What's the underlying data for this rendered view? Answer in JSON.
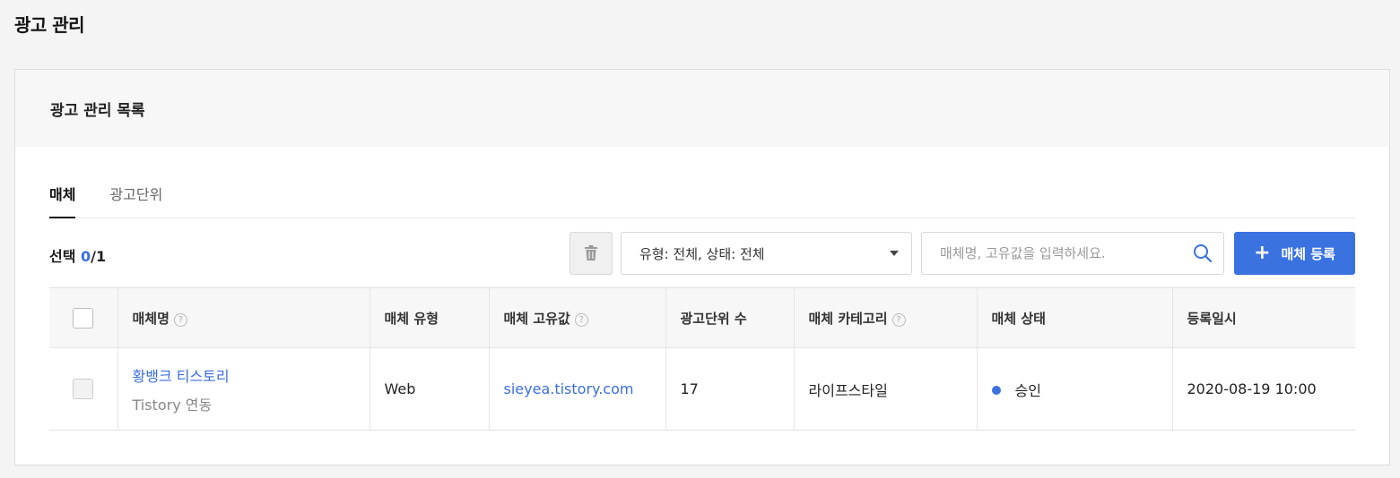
{
  "page": {
    "title": "광고 관리"
  },
  "card": {
    "title": "광고 관리 목록"
  },
  "tabs": [
    {
      "label": "매체",
      "active": true
    },
    {
      "label": "광고단위",
      "active": false
    }
  ],
  "toolbar": {
    "selection_label": "선택",
    "selected": "0",
    "total": "/1",
    "filter_value": "유형: 전체, 상태: 전체",
    "search_placeholder": "매체명, 고유값을 입력하세요.",
    "add_label": "매체 등록"
  },
  "table": {
    "headers": [
      "매체명",
      "매체 유형",
      "매체 고유값",
      "광고단위 수",
      "매체 카테고리",
      "매체 상태",
      "등록일시"
    ],
    "rows": [
      {
        "name": "황뱅크 티스토리",
        "sub": "Tistory 연동",
        "type": "Web",
        "unique_value": "sieyea.tistory.com",
        "ad_unit_count": "17",
        "category": "라이프스타일",
        "status": "승인",
        "registered": "2020-08-19 10:00"
      }
    ]
  },
  "colors": {
    "accent": "#3a72e0",
    "link": "#3b6ee0"
  },
  "icons": [
    "trash-icon",
    "search-icon",
    "plus-icon",
    "help-icon",
    "chevron-down-icon"
  ]
}
